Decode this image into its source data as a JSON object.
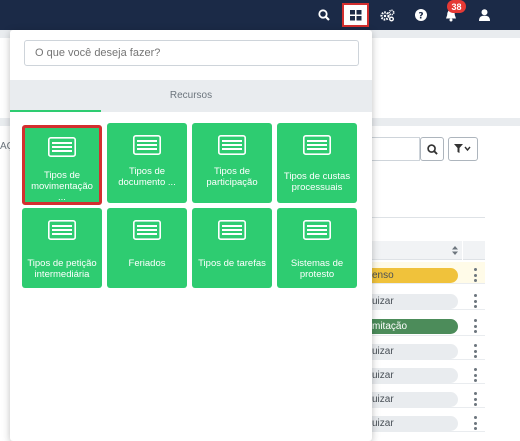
{
  "navbar": {
    "icons": [
      "search-icon",
      "apps-grid-icon",
      "settings-cogs-icon",
      "help-icon",
      "bell-icon",
      "user-icon"
    ],
    "notification_count": "38",
    "colors": {
      "bar": "#1b2a47",
      "badge": "#e53935",
      "highlight": "#d32f2f"
    }
  },
  "dropdown": {
    "search_placeholder": "O que você deseja fazer?",
    "tab_label": "Recursos",
    "accent": "#2ecc71",
    "tiles": [
      {
        "label": "Tipos de movimentação ...",
        "icon": "list-card-icon",
        "highlighted": true
      },
      {
        "label": "Tipos de documento ...",
        "icon": "list-card-icon"
      },
      {
        "label": "Tipos de participação",
        "icon": "list-card-icon"
      },
      {
        "label": "Tipos de custas processuais",
        "icon": "list-card-icon"
      },
      {
        "label": "Tipos de petição intermediária",
        "icon": "list-card-icon"
      },
      {
        "label": "Feriados",
        "icon": "list-card-icon"
      },
      {
        "label": "Tipos de tarefas",
        "icon": "list-card-icon"
      },
      {
        "label": "Sistemas de protesto",
        "icon": "list-card-icon"
      }
    ]
  },
  "background": {
    "left_fragment": "AÇ",
    "pills": [
      {
        "text": "enso",
        "color": "#f0c23b"
      },
      {
        "text": "uizar",
        "color": "#e9ecef"
      },
      {
        "text": "mitação",
        "color": "#4c8c5a"
      },
      {
        "text": "uizar",
        "color": "#e9ecef"
      },
      {
        "text": "uizar",
        "color": "#e9ecef"
      },
      {
        "text": "uizar",
        "color": "#e9ecef"
      },
      {
        "text": "uizar",
        "color": "#e9ecef"
      }
    ]
  }
}
